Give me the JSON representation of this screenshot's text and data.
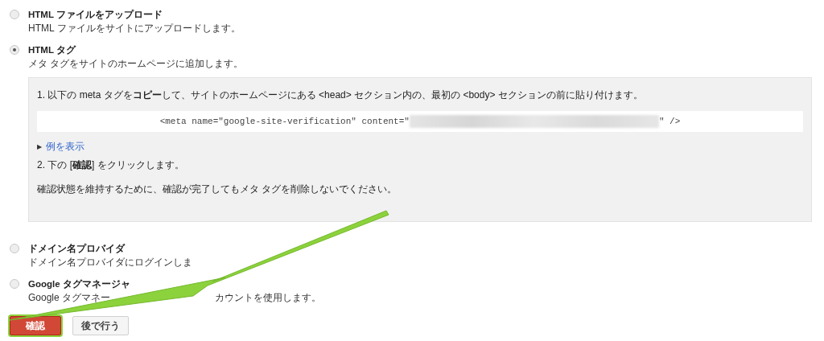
{
  "options": [
    {
      "kind": "plain",
      "label": "HTML ファイルをアップロード",
      "description": [
        "HTML ファイルをサイトにアップロードします。"
      ],
      "selected": false
    },
    {
      "kind": "instructions",
      "label": "HTML タグ",
      "description": [
        "メタ タグをサイトのホームページに追加します。"
      ],
      "selected": true,
      "panel": {
        "step1": "1. 以下の meta タグを**コピー**して、サイトのホームページにある <head> セクション内の、最初の <body> セクションの前に貼り付けます。",
        "code_before": "<meta name=\"google-site-verification\" content=\"",
        "code_after": "\" />",
        "toggle_icon": "▶",
        "toggle_link": "例を表示",
        "step2": "2. 下の [**確認**] をクリックします。",
        "note": "確認状態を維持するために、確認が完了してもメタ タグを削除しないでください。"
      }
    },
    {
      "kind": "plain",
      "label": "ドメイン名プロバイダ",
      "description": [
        "ドメイン名プロバイダにログインしま"
      ],
      "selected": false
    },
    {
      "kind": "plain",
      "label": "Google タグマネージャ",
      "description": [
        "Google タグマネー",
        "カウントを使用します。"
      ],
      "selected": false
    }
  ],
  "buttons": [
    {
      "kind": "primary",
      "label": "確認",
      "highlighted": true
    },
    {
      "kind": "secondary",
      "label": "後で行う",
      "highlighted": false
    }
  ]
}
